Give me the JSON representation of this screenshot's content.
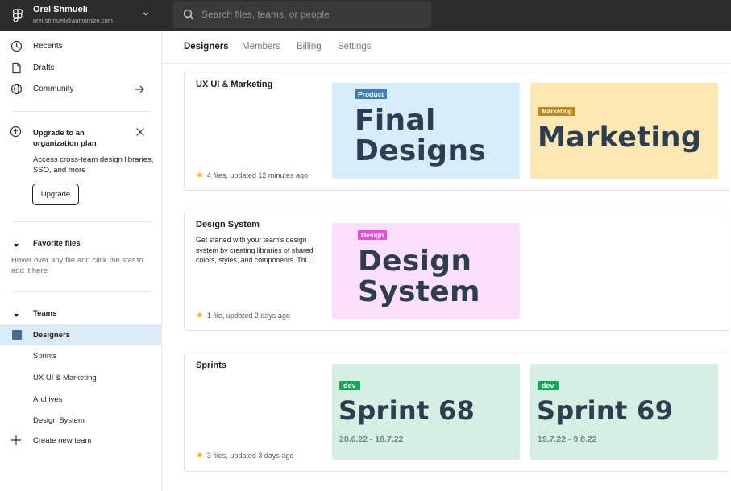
{
  "topbar": {
    "user_name": "Orel Shmueli",
    "user_email": "orel.shmueli@authomize.com",
    "search_placeholder": "Search files, teams, or people"
  },
  "sidebar": {
    "nav": [
      {
        "label": "Recents",
        "icon": "clock-icon"
      },
      {
        "label": "Drafts",
        "icon": "file-icon"
      },
      {
        "label": "Community",
        "icon": "globe-icon"
      }
    ],
    "upgrade": {
      "title": "Upgrade to an organization plan",
      "description": "Access cross-team design libraries, SSO, and more",
      "button": "Upgrade"
    },
    "favorites": {
      "title": "Favorite files",
      "hint": "Hover over any file and click the star to add it here"
    },
    "teams": {
      "title": "Teams",
      "items": [
        "Designers",
        "Sprints",
        "UX UI & Marketing",
        "Archives",
        "Design System"
      ],
      "active": "Designers",
      "create": "Create new team"
    }
  },
  "tabs": [
    "Designers",
    "Members",
    "Billing",
    "Settings"
  ],
  "active_tab": "Designers",
  "projects": [
    {
      "title": "UX UI & Marketing",
      "description": "",
      "meta": "4 files, updated 12 minutes ago",
      "thumbnails": [
        {
          "badge": "Product",
          "badge_color": "#3d7fb8",
          "bg": "#d6ecfb",
          "title": "Final Designs",
          "subtitle": ""
        },
        {
          "badge": "Marketing",
          "badge_color": "#c08a16",
          "bg": "#fde8b4",
          "title": "Marketing",
          "subtitle": ""
        }
      ]
    },
    {
      "title": "Design System",
      "description": "Get started with your team's design system by creating libraries of shared colors, styles, and components. Thi...",
      "meta": "1 file, updated 2 days ago",
      "thumbnails": [
        {
          "badge": "Design",
          "badge_color": "#e84fd9",
          "bg": "#fbdffb",
          "title": "Design System",
          "subtitle": ""
        }
      ]
    },
    {
      "title": "Sprints",
      "description": "",
      "meta": "3 files, updated 3 days ago",
      "thumbnails": [
        {
          "badge": "dev",
          "badge_color": "#18a656",
          "bg": "#d6efe3",
          "title": "Sprint 68",
          "subtitle": "28.6.22 - 18.7.22"
        },
        {
          "badge": "dev",
          "badge_color": "#18a656",
          "bg": "#d6efe3",
          "title": "Sprint 69",
          "subtitle": "19.7.22 - 9.8.22"
        }
      ]
    }
  ],
  "colors": {
    "topbar": "#2c2c2c",
    "active_team_bg": "#daebf7",
    "team_square": "#4a6b92",
    "star": "#f2b41c"
  }
}
